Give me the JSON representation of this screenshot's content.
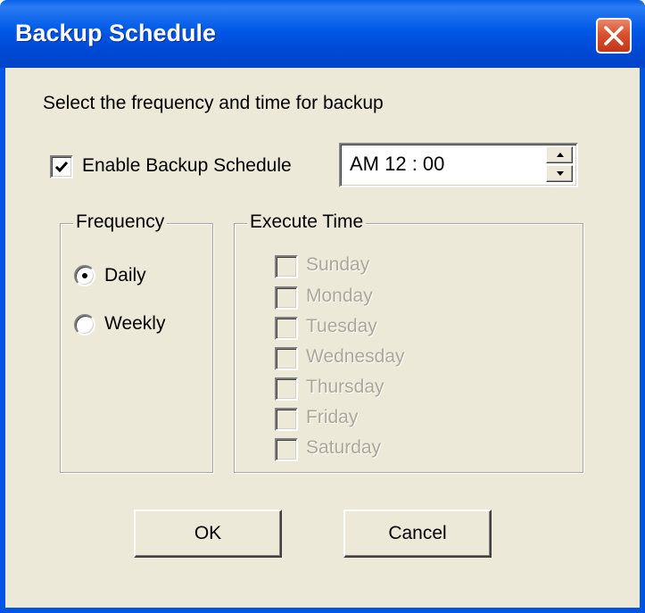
{
  "window": {
    "title": "Backup Schedule",
    "close_label": "close"
  },
  "dialog": {
    "instruction": "Select the frequency and time for backup",
    "enable_label": "Enable Backup Schedule",
    "enable_checked": true,
    "time_value": "AM 12 : 00"
  },
  "frequency": {
    "legend": "Frequency",
    "options": [
      {
        "label": "Daily",
        "selected": true
      },
      {
        "label": "Weekly",
        "selected": false
      }
    ]
  },
  "execute_time": {
    "legend": "Execute Time",
    "enabled": false,
    "days": [
      {
        "label": "Sunday",
        "checked": false
      },
      {
        "label": "Monday",
        "checked": false
      },
      {
        "label": "Tuesday",
        "checked": false
      },
      {
        "label": "Wednesday",
        "checked": false
      },
      {
        "label": "Thursday",
        "checked": false
      },
      {
        "label": "Friday",
        "checked": false
      },
      {
        "label": "Saturday",
        "checked": false
      }
    ]
  },
  "buttons": {
    "ok": "OK",
    "cancel": "Cancel"
  },
  "colors": {
    "titlebar": "#0054e3",
    "face": "#ece9d8",
    "close": "#d9522f",
    "disabled_text": "#aca899"
  }
}
